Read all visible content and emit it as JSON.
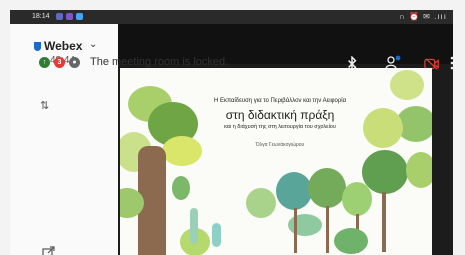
{
  "status_bar": {
    "time": "18:14",
    "right_icons": "∩ ⏰ ✉ .ııı"
  },
  "header": {
    "app_name": "Webex",
    "duration": "48:44"
  },
  "banner": {
    "badge_count": "3",
    "message": "The meeting room is locked."
  },
  "slide": {
    "line1": "Η Εκπαίδευση για το Περιβάλλον και την Αειφορία",
    "title": "στη διδακτική πράξη",
    "line3": "και η διάχυσή της στη λειτουργία του σχολείου",
    "author": "Όλγα Γεωνάκογιώρου"
  },
  "icons": {
    "bluetooth": "bluetooth-icon",
    "participants": "participants-icon",
    "video_off": "video-off-icon",
    "more": "more-icon",
    "layout": "layout-icon",
    "share": "share-screen-icon"
  },
  "colors": {
    "accent": "#1b6ac9",
    "alert": "#e53935",
    "video_off": "#e53935"
  }
}
